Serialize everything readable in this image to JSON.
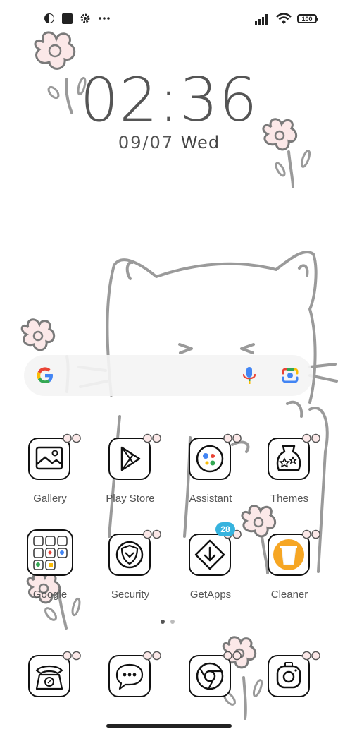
{
  "status": {
    "icons": [
      "circle-half-icon",
      "stop-square-icon",
      "gear-icon",
      "more-icon",
      "signal-icon",
      "wifi-icon",
      "battery-icon"
    ],
    "battery": "100"
  },
  "lockscreen": {
    "time": "02:36",
    "date": "09/07",
    "weekday": "Wed"
  },
  "search": {
    "icons": [
      "google-logo-icon",
      "microphone-icon",
      "lens-camera-icon"
    ]
  },
  "apps": [
    {
      "label": "Gallery",
      "icon": "gallery-icon"
    },
    {
      "label": "Play Store",
      "icon": "play-store-icon"
    },
    {
      "label": "Assistant",
      "icon": "assistant-icon"
    },
    {
      "label": "Themes",
      "icon": "themes-icon"
    },
    {
      "label": "Google",
      "icon": "google-folder-icon"
    },
    {
      "label": "Security",
      "icon": "security-icon"
    },
    {
      "label": "GetApps",
      "icon": "getapps-icon",
      "badge": "28"
    },
    {
      "label": "Cleaner",
      "icon": "cleaner-icon"
    }
  ],
  "dock": [
    {
      "icon": "phone-icon"
    },
    {
      "icon": "messages-icon"
    },
    {
      "icon": "chrome-icon"
    },
    {
      "icon": "camera-icon"
    }
  ],
  "colors": {
    "background": "#ffffff",
    "flower": "#fbe8e8",
    "line": "#8a8a8a",
    "badge": "#36b3de",
    "cleaner": "#f6a623"
  },
  "pager": {
    "current": 1,
    "total": 2
  }
}
